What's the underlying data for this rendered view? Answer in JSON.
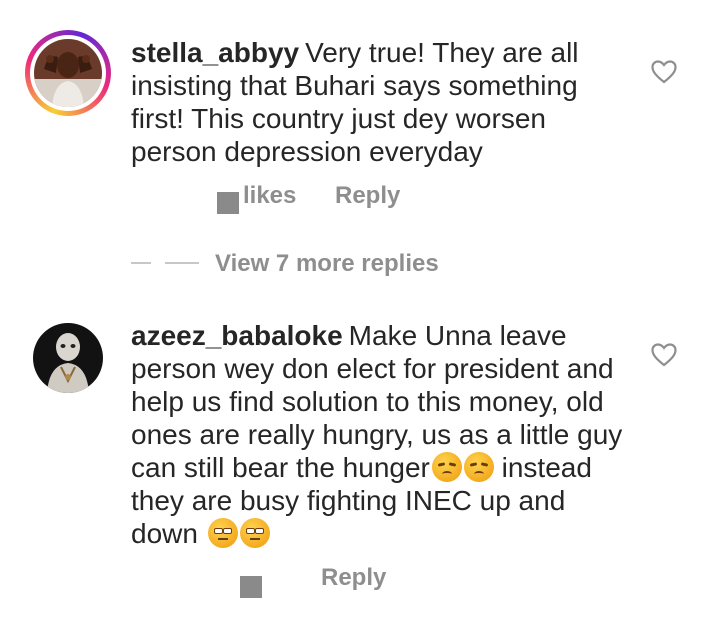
{
  "comments": [
    {
      "username": "stella_abbyy",
      "text": "Very true! They are all insisting that Buhari says something first! This country just dey worsen person depression everyday",
      "likes_label": "likes",
      "reply_label": "Reply"
    },
    {
      "username": "azeez_babaloke",
      "text_before_emoji": "Make Unna leave person wey don elect for president and help us find solution to this money, old ones are really hungry, us as a little guy can still bear the hunger",
      "text_middle": " instead they are busy fighting INEC up and down ",
      "emojis_first": [
        "disappointed-face",
        "disappointed-face"
      ],
      "emojis_last": [
        "unamused-face",
        "unamused-face"
      ],
      "reply_label": "Reply"
    }
  ],
  "view_replies": {
    "label": "View 7 more replies"
  },
  "icons": {
    "like": "heart-outline-icon"
  },
  "colors": {
    "text": "#262626",
    "muted": "#8e8e8e",
    "story_ring_start": "#f9ce34",
    "story_ring_mid": "#ee2a7b",
    "story_ring_end": "#6228d7"
  }
}
